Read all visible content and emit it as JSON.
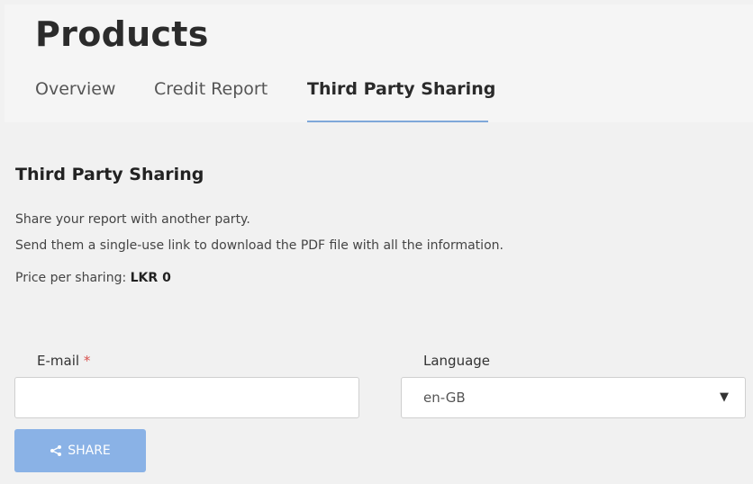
{
  "header": {
    "title": "Products",
    "tabs": [
      {
        "label": "Overview",
        "active": false
      },
      {
        "label": "Credit Report",
        "active": false
      },
      {
        "label": "Third Party Sharing",
        "active": true
      }
    ]
  },
  "section": {
    "title": "Third Party Sharing",
    "description_1": "Share your report with another party.",
    "description_2": "Send them a single-use link to download the PDF file with all the information.",
    "price_label": "Price per sharing:",
    "price_value": "LKR 0"
  },
  "form": {
    "email": {
      "label": "E-mail",
      "required_mark": "*",
      "value": "",
      "placeholder": ""
    },
    "language": {
      "label": "Language",
      "selected": "en-GB"
    },
    "share_button": {
      "label": "SHARE",
      "icon": "share-icon",
      "color": "#8ab2e6"
    }
  },
  "colors": {
    "active_tab_underline": "#7fa8d9",
    "required": "#d9534f"
  }
}
